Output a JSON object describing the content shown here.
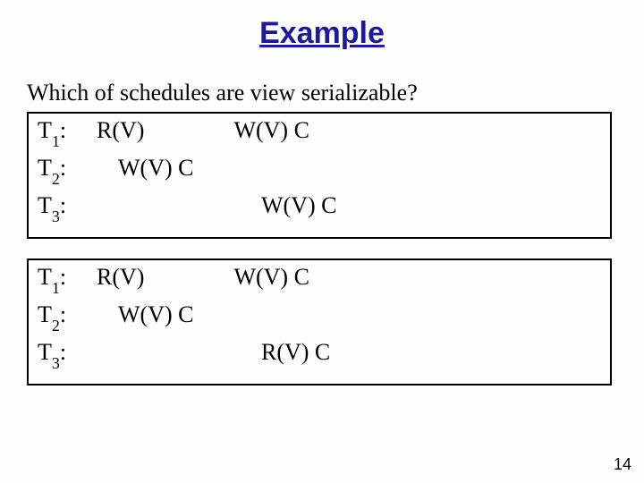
{
  "title": "Example",
  "question": "Which of schedules are view serializable?",
  "schedules": [
    {
      "rows": [
        {
          "t_label": "T",
          "t_sub": "1",
          "t_colon": ":",
          "ops": [
            {
              "col": "c1",
              "text": "R(V)"
            },
            {
              "col": "c3",
              "text": "W(V) C"
            }
          ]
        },
        {
          "t_label": "T",
          "t_sub": "2",
          "t_colon": ":",
          "ops": [
            {
              "col": "c2",
              "text": "W(V) C"
            }
          ]
        },
        {
          "t_label": "T",
          "t_sub": "3",
          "t_colon": ":",
          "ops": [
            {
              "col": "c4",
              "text": "W(V) C"
            }
          ]
        }
      ]
    },
    {
      "rows": [
        {
          "t_label": "T",
          "t_sub": "1",
          "t_colon": ":",
          "ops": [
            {
              "col": "c1",
              "text": "R(V)"
            },
            {
              "col": "c3",
              "text": "W(V) C"
            }
          ]
        },
        {
          "t_label": "T",
          "t_sub": "2",
          "t_colon": ":",
          "ops": [
            {
              "col": "c2",
              "text": "W(V) C"
            }
          ]
        },
        {
          "t_label": "T",
          "t_sub": "3",
          "t_colon": ":",
          "ops": [
            {
              "col": "c4",
              "text": "R(V) C"
            }
          ]
        }
      ]
    }
  ],
  "page_number": "14"
}
